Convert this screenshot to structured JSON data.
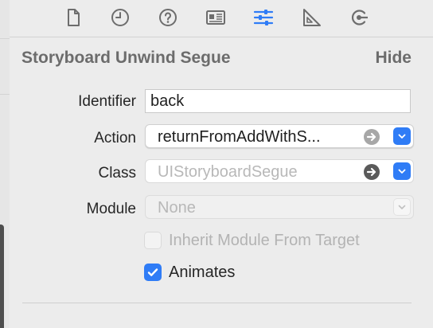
{
  "inspector": {
    "tabs": [
      {
        "icon": "file-icon",
        "active": false
      },
      {
        "icon": "clock-icon",
        "active": false
      },
      {
        "icon": "question-icon",
        "active": false
      },
      {
        "icon": "identity-card-icon",
        "active": false
      },
      {
        "icon": "sliders-icon",
        "active": true
      },
      {
        "icon": "ruler-icon",
        "active": false
      },
      {
        "icon": "connections-icon",
        "active": false
      }
    ],
    "section_title": "Storyboard Unwind Segue",
    "hide_label": "Hide",
    "identifier": {
      "label": "Identifier",
      "value": "back"
    },
    "action": {
      "label": "Action",
      "value": "returnFromAddWithS..."
    },
    "class": {
      "label": "Class",
      "placeholder": "UIStoryboardSegue"
    },
    "module": {
      "label": "Module",
      "placeholder": "None"
    },
    "inherit_module": {
      "label": "Inherit Module From Target",
      "checked": false,
      "enabled": false
    },
    "animates": {
      "label": "Animates",
      "checked": true
    }
  },
  "colors": {
    "accent": "#2f7cf6",
    "background": "#ececec",
    "muted_text": "#6c6c6c",
    "placeholder_text": "#b8b8b8"
  }
}
